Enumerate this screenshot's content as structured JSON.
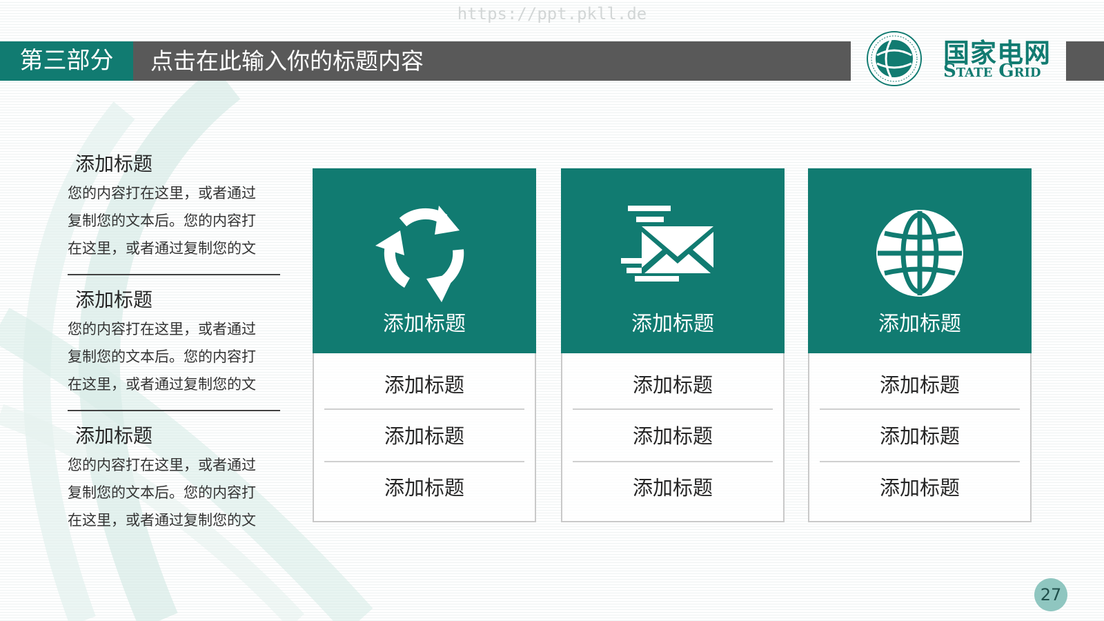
{
  "watermark": "https://ppt.pkll.de",
  "header": {
    "section_label": "第三部分",
    "title": "点击在此输入你的标题内容"
  },
  "logo": {
    "emblem_text": "国家电网公司 STATE GRID CORPORATION OF CHINA",
    "chinese_name": "国家电网",
    "english_name": "State Grid"
  },
  "left_items": [
    {
      "title": "添加标题",
      "lines": [
        "您的内容打在这里，或者通过",
        "复制您的文本后。您的内容打",
        "在这里，或者通过复制您的文"
      ]
    },
    {
      "title": "添加标题",
      "lines": [
        "您的内容打在这里，或者通过",
        "复制您的文本后。您的内容打",
        "在这里，或者通过复制您的文"
      ]
    },
    {
      "title": "添加标题",
      "lines": [
        "您的内容打在这里，或者通过",
        "复制您的文本后。您的内容打",
        "在这里，或者通过复制您的文"
      ]
    }
  ],
  "cards": [
    {
      "icon": "recycle-icon",
      "title": "添加标题",
      "rows": [
        "添加标题",
        "添加标题",
        "添加标题"
      ]
    },
    {
      "icon": "mail-icon",
      "title": "添加标题",
      "rows": [
        "添加标题",
        "添加标题",
        "添加标题"
      ]
    },
    {
      "icon": "globe-icon",
      "title": "添加标题",
      "rows": [
        "添加标题",
        "添加标题",
        "添加标题"
      ]
    }
  ],
  "page_number": "27",
  "colors": {
    "accent": "#117b71",
    "header_gray": "#595959",
    "page_badge": "#8fc6c0"
  }
}
